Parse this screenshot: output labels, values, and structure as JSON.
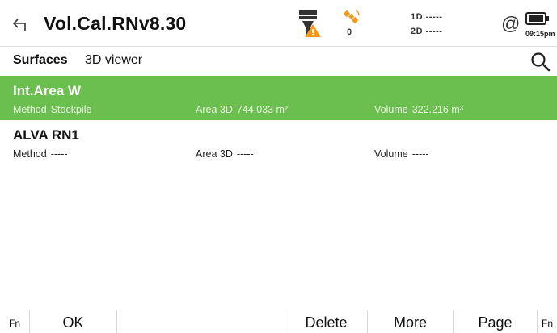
{
  "header": {
    "title": "Vol.Cal.RNv8.30",
    "satellites": "0",
    "quality_1d": "1D -----",
    "quality_2d": "2D -----",
    "at_symbol": "@",
    "time": "09:15pm"
  },
  "tabs": [
    {
      "label": "Surfaces",
      "active": true
    },
    {
      "label": "3D viewer",
      "active": false
    }
  ],
  "surfaces": [
    {
      "name": "Int.Area W",
      "method_label": "Method",
      "method": "Stockpile",
      "area_label": "Area 3D",
      "area": "744.033 m²",
      "volume_label": "Volume",
      "volume": "322.216 m³",
      "selected": true
    },
    {
      "name": "ALVA RN1",
      "method_label": "Method",
      "method": "-----",
      "area_label": "Area 3D",
      "area": "-----",
      "volume_label": "Volume",
      "volume": "-----",
      "selected": false
    }
  ],
  "softkeys": {
    "fn_left": "Fn",
    "ok": "OK",
    "delete": "Delete",
    "more": "More",
    "page": "Page",
    "fn_right": "Fn"
  },
  "colors": {
    "selected_row": "#6bbf4e",
    "warning": "#f29a1f"
  }
}
